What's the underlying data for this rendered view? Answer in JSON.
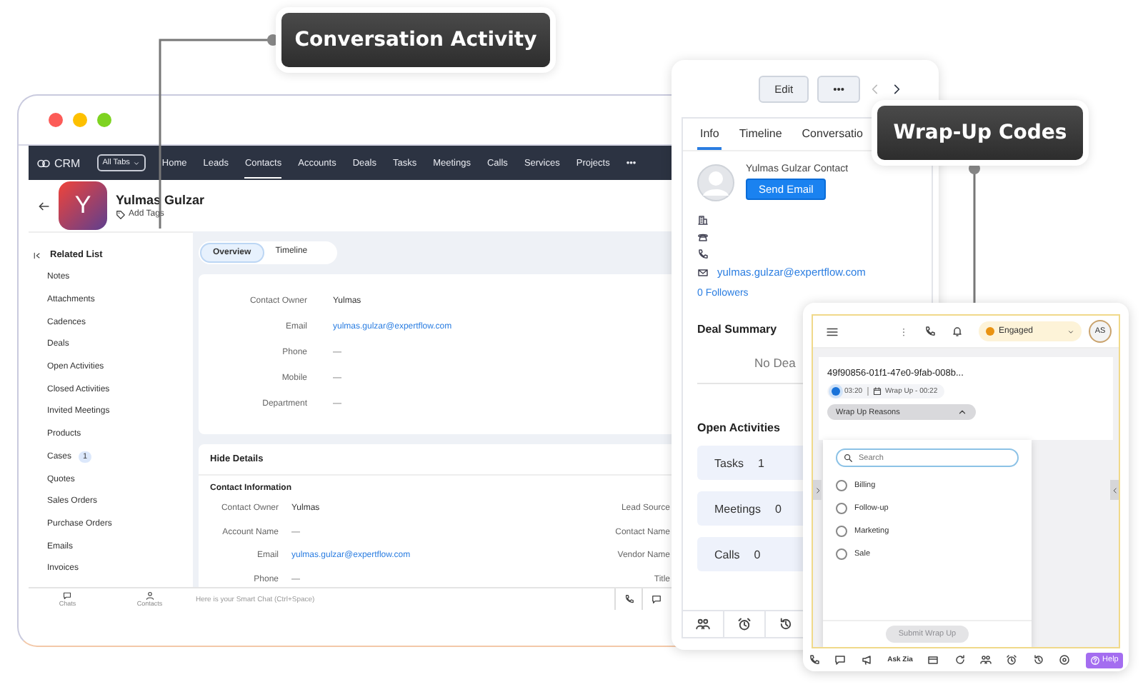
{
  "callouts": [
    {
      "text": "Conversation Activity"
    },
    {
      "text": "Wrap-Up Codes"
    }
  ],
  "crm_window": {
    "nav": {
      "logo": "CRM",
      "all_tabs": "All Tabs",
      "more": "•••",
      "tabs": [
        {
          "label": "Home",
          "selected": false
        },
        {
          "label": "Leads",
          "selected": false
        },
        {
          "label": "Contacts",
          "selected": true
        },
        {
          "label": "Accounts",
          "selected": false
        },
        {
          "label": "Deals",
          "selected": false
        },
        {
          "label": "Tasks",
          "selected": false
        },
        {
          "label": "Meetings",
          "selected": false
        },
        {
          "label": "Calls",
          "selected": false
        },
        {
          "label": "Services",
          "selected": false
        },
        {
          "label": "Projects",
          "selected": false
        }
      ]
    },
    "record": {
      "initial": "Y",
      "name": "Yulmas Gulzar",
      "add_tags": "Add Tags"
    },
    "related_list": {
      "title": "Related List",
      "items": [
        {
          "label": "Notes"
        },
        {
          "label": "Attachments"
        },
        {
          "label": "Cadences"
        },
        {
          "label": "Deals"
        },
        {
          "label": "Open Activities"
        },
        {
          "label": "Closed Activities"
        },
        {
          "label": "Invited Meetings"
        },
        {
          "label": "Products"
        },
        {
          "label": "Cases",
          "count": "1"
        },
        {
          "label": "Quotes"
        },
        {
          "label": "Sales Orders"
        },
        {
          "label": "Purchase Orders"
        },
        {
          "label": "Emails"
        },
        {
          "label": "Invoices"
        }
      ]
    },
    "view_tabs": [
      {
        "label": "Overview",
        "selected": true
      },
      {
        "label": "Timeline",
        "selected": false
      }
    ],
    "overview_fields": [
      {
        "label": "Contact Owner",
        "value": "Yulmas",
        "kind": "text"
      },
      {
        "label": "Email",
        "value": "yulmas.gulzar@expertflow.com",
        "kind": "link"
      },
      {
        "label": "Phone",
        "value": "—",
        "kind": "empty"
      },
      {
        "label": "Mobile",
        "value": "—",
        "kind": "empty"
      },
      {
        "label": "Department",
        "value": "—",
        "kind": "empty"
      }
    ],
    "details": {
      "toggle": "Hide Details",
      "section": "Contact Information",
      "fields": [
        {
          "label": "Contact Owner",
          "value": "Yulmas",
          "kind": "text",
          "right_label": "Lead Source"
        },
        {
          "label": "Account Name",
          "value": "—",
          "kind": "empty",
          "right_label": "Contact Name"
        },
        {
          "label": "Email",
          "value": "yulmas.gulzar@expertflow.com",
          "kind": "link",
          "right_label": "Vendor Name"
        },
        {
          "label": "Phone",
          "value": "—",
          "kind": "empty",
          "right_label": "Title"
        }
      ]
    },
    "chat_bar": {
      "shortcuts": [
        {
          "label": "Chats"
        },
        {
          "label": "Contacts"
        }
      ],
      "placeholder": "Here is your Smart Chat (Ctrl+Space)"
    }
  },
  "side_panel": {
    "buttons": [
      {
        "label": "Edit"
      },
      {
        "label": "•••"
      }
    ],
    "tabs": [
      {
        "label": "Info",
        "selected": true
      },
      {
        "label": "Timeline",
        "selected": false
      },
      {
        "label": "Conversatio",
        "selected": false
      }
    ],
    "contact": {
      "name": "Yulmas Gulzar",
      "role": "Contact",
      "send_email": "Send Email",
      "email": "yulmas.gulzar@expertflow.com",
      "followers": "0 Followers"
    },
    "deal_summary": {
      "title": "Deal Summary",
      "empty": "No Dea"
    },
    "open_activities": {
      "title": "Open Activities",
      "items": [
        {
          "label": "Tasks",
          "count": "1"
        },
        {
          "label": "Meetings",
          "count": "0"
        },
        {
          "label": "Calls",
          "count": "0"
        }
      ]
    }
  },
  "widget": {
    "status": "Engaged",
    "avatar": "AS",
    "conversation_id": "49f90856-01f1-47e0-9fab-008b...",
    "timer": "03:20",
    "wrap_up_timer": "Wrap Up - 00:22",
    "reasons_toggle": "Wrap Up Reasons",
    "search_placeholder": "Search",
    "reasons": [
      {
        "label": "Billing",
        "selected": false
      },
      {
        "label": "Follow-up",
        "selected": false
      },
      {
        "label": "Marketing",
        "selected": false
      },
      {
        "label": "Sale",
        "selected": false
      }
    ],
    "submit": {
      "label": "Submit Wrap Up",
      "disabled": true
    },
    "ask_zia": "Ask Zia",
    "help": "Help"
  }
}
